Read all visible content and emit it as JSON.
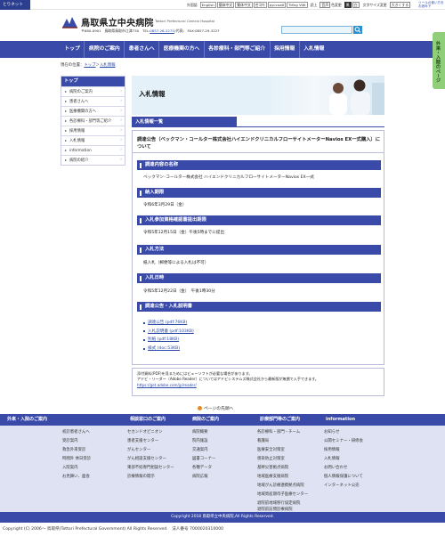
{
  "topbar": {
    "skip_label": "とりネット",
    "lang_label": "外国語",
    "languages": [
      "English",
      "簡体中文",
      "繁体中文",
      "한국어",
      "русский",
      "Tiếng Việt"
    ],
    "read_aloud": "読上",
    "voice": "音声",
    "color_change": "色変更",
    "color_btns": [
      "黒",
      "白"
    ],
    "text_size_label": "文字サイズ変更",
    "size_large": "大きくする",
    "top_link": "ツールの使い方をお読み下"
  },
  "header": {
    "hospital_name": "鳥取県立中央病院",
    "hospital_en": "Tottori Prefectural Central Hospital",
    "address": "〒680-0901　鳥取県鳥取市江津730　TEL:",
    "tel": "0857-26-2271",
    "fax": "(代表)　FAX:0857-29-3227",
    "search_placeholder": ""
  },
  "nav": {
    "items": [
      "トップ",
      "病院のご案内",
      "患者さんへ",
      "医療機関の方へ",
      "各診療科・部門等ご紹介",
      "採用情報",
      "入札情報"
    ]
  },
  "side_tab": {
    "label": "外来・入院のページ"
  },
  "breadcrumb": {
    "prefix": "現在の位置：",
    "top": "トップ",
    "sep": "＞",
    "current": "入札情報"
  },
  "sidebar": {
    "head": "トップ",
    "items": [
      "病院のご案内",
      "患者さんへ",
      "医療機関の方へ",
      "各診療科・部門等ご紹介",
      "採用情報",
      "入札情報",
      "information",
      "病院の紹介"
    ]
  },
  "hero": {
    "title": "入札情報"
  },
  "section": {
    "tab": "入札情報一覧"
  },
  "notice": {
    "title": "調達公告（ベックマン・コールター株式会社ハイエンドクリニカルフローサイトメーターNavios EX一式購入）について",
    "sections": [
      {
        "heading": "調達内容の名称",
        "text": "ベックマン･コールター株式会社 ハイエンドクリニカルフローサイトメーターNavios EX一式"
      },
      {
        "heading": "納入期限",
        "text": "令和6年3月29日（金）"
      },
      {
        "heading": "入札参加資格確認書提出期限",
        "text": "令和5年12月15日（金）午後5時までに提出"
      },
      {
        "heading": "入札方法",
        "text": "紙入札（郵便等による入札は不可）"
      },
      {
        "heading": "入札日時",
        "text": "令和5年12月22日（金）　午後1時30分"
      },
      {
        "heading": "調達公告・入札説明書",
        "text": ""
      }
    ],
    "docs": [
      "調達公告 (pdf:76KB)",
      "入札説明書 (pdf:103KB)",
      "別紙 (pdf:18KB)",
      "様式 (doc:53KB)"
    ]
  },
  "pdf_note": {
    "line1": "添付資料(PDF)を見るためにはビューソフトが必要な場合があります。",
    "line2": "アドビ・リーダー（Adobe Reader）についてはアドビシステムズ株式会社から最新版が無償で入手できます。",
    "url": "https://get.adobe.com/jp/reader/"
  },
  "to_top": {
    "label": "ページの先頭へ"
  },
  "footer": {
    "columns": [
      {
        "head": "外来・入院のご案内",
        "links": [
          "初診患者さんへ",
          "受診案内",
          "救急外来受診",
          "時間外 休日受診",
          "入院案内",
          "お見舞い、面会"
        ]
      },
      {
        "head": "相談窓口のご案内",
        "links": [
          "セカンドオピニオン",
          "患者支援センター",
          "がんセンター",
          "がん相談支援センター",
          "東部不妊専門相談センター",
          "診療情報の開示"
        ]
      },
      {
        "head": "病院のご案内",
        "links": [
          "病院概要",
          "院内施設",
          "交通案内",
          "図書コーナー",
          "各種データ",
          "病院広報"
        ]
      },
      {
        "head": "診療部門等のご案内",
        "links": [
          "各診療科・部門・チーム",
          "看護局",
          "医療安全対策室",
          "感染防止対策室",
          "基幹災害拠点病院",
          "地域医療支援病院",
          "地域がん診療連携拠点病院",
          "地域周産期母子医療センター",
          "退院前地域移行協定病院",
          "退院前訪問診療病院"
        ]
      },
      {
        "head": "information",
        "links": [
          "お知らせ",
          "公開セミナー・研修会",
          "採用情報",
          "入札情報",
          "お問い合わせ",
          "個人情報保護について",
          "インターネット公売"
        ]
      }
    ],
    "copyright": "Copyright 2018 鳥取県立中央病院,All Rights Reserved.",
    "bottom": "Copyright (C) 2006～ 鳥取県(Tottori Prefectural Government) All Rights Reserved.　法人番号 7000020310000"
  }
}
